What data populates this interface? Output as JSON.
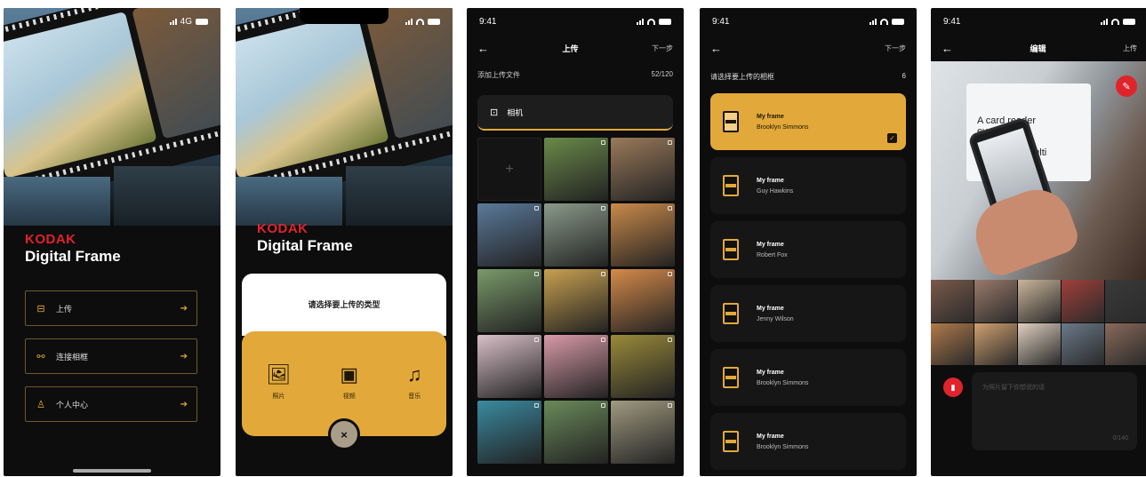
{
  "colors": {
    "accent": "#e2a93a",
    "brand_red": "#e0242b",
    "background": "#0d0d0d"
  },
  "screen1": {
    "status": {
      "right": "4G"
    },
    "brand": {
      "kodak": "KODAK",
      "product": "Digital Frame"
    },
    "menu": [
      {
        "label": "上传",
        "icon": "upload-icon"
      },
      {
        "label": "连接相框",
        "icon": "link-icon"
      },
      {
        "label": "个人中心",
        "icon": "user-icon"
      }
    ]
  },
  "screen2": {
    "brand": {
      "kodak": "KODAK",
      "product": "Digital Frame"
    },
    "sheet_title": "请选择要上传的类型",
    "options": [
      {
        "label": "照片",
        "icon": "image-icon"
      },
      {
        "label": "视频",
        "icon": "film-icon"
      },
      {
        "label": "音乐",
        "icon": "music-icon"
      }
    ],
    "close_label": "×"
  },
  "screen3": {
    "time": "9:41",
    "nav": {
      "title": "上传",
      "action": "下一步"
    },
    "add_files_label": "添加上传文件",
    "count": "52/120",
    "album_label": "相机",
    "photo_colors": [
      "#1a1a1a",
      "#6a8a4a",
      "#9a7a5a",
      "#5a7a9a",
      "#8a9a8a",
      "#c98a4a",
      "#7a9a6a",
      "#c8a050",
      "#d58a4a",
      "#d8c0c8",
      "#d89aa8",
      "#9a8a3a",
      "#3a8aa0",
      "#6a8a5a",
      "#a09a80"
    ]
  },
  "screen4": {
    "time": "9:41",
    "nav": {
      "action": "下一步"
    },
    "header_label": "请选择要上传的相框",
    "count": "6",
    "frames": [
      {
        "title": "My frame",
        "owner": "Brooklyn Simmons",
        "selected": true
      },
      {
        "title": "My frame",
        "owner": "Guy Hawkins",
        "selected": false
      },
      {
        "title": "My frame",
        "owner": "Robert Fox",
        "selected": false
      },
      {
        "title": "My frame",
        "owner": "Jenny Wilson",
        "selected": false
      },
      {
        "title": "My frame",
        "owner": "Brooklyn Simmons",
        "selected": false
      },
      {
        "title": "My frame",
        "owner": "Brooklyn Simmons",
        "selected": false
      }
    ]
  },
  "screen5": {
    "time": "9:41",
    "nav": {
      "title": "编辑",
      "action": "上传"
    },
    "photo_text": "A card reader\nevery\n\nRoomlevel Multi",
    "caption_placeholder": "为照片留下你想说的话",
    "caption_count": "0/140",
    "thumb_colors": [
      "#7a5a4a",
      "#9a7a6a",
      "#c9b59a",
      "#a0403a",
      "#3a3a3a",
      "#b07a4a",
      "#d0a070",
      "#e0d0c0",
      "#6a7a8a",
      "#8a6a5a"
    ]
  }
}
